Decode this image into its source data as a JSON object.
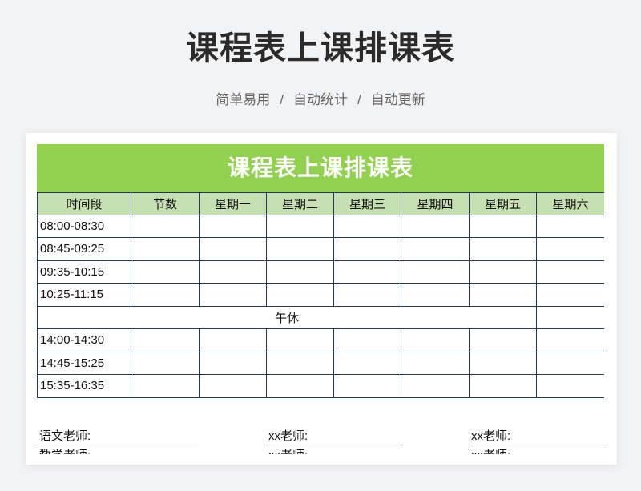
{
  "page": {
    "title": "课程表上课排课表",
    "features": [
      "简单易用",
      "自动统计",
      "自动更新"
    ],
    "separator": "/"
  },
  "sheet": {
    "title": "课程表上课排课表",
    "columns": [
      "时间段",
      "节数",
      "星期一",
      "星期二",
      "星期三",
      "星期四",
      "星期五",
      "星期六"
    ],
    "morning": [
      "08:00-08:30",
      "08:45-09:25",
      "09:35-10:15",
      "10:25-11:15"
    ],
    "lunch": "午休",
    "afternoon": [
      "14:00-14:30",
      "14:45-15:25",
      "15:35-16:35"
    ]
  },
  "teachers": [
    [
      "语文老师:",
      "xx老师:",
      "xx老师:"
    ],
    [
      "数学老师:",
      "xx老师:",
      "xx老师:"
    ]
  ],
  "colors": {
    "background": "#f2f3f5",
    "banner": "#92d050",
    "header": "#c6e0b4",
    "border": "#203864"
  }
}
